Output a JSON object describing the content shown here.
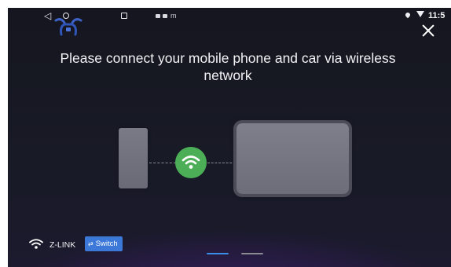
{
  "status_bar": {
    "back_icon": "nav-back-icon",
    "home_icon": "nav-home-icon",
    "recents_icon": "nav-recents-icon",
    "notification_c_glyph": "m",
    "time": "11:5"
  },
  "header": {
    "logo_icon": "zlink-logo-icon",
    "close_icon": "close-icon"
  },
  "main": {
    "instruction": "Please connect your mobile phone and car via wireless network",
    "wifi_badge_color": "#4caf57",
    "phone_icon": "phone-icon",
    "car_screen_icon": "car-screen-icon"
  },
  "footer": {
    "connection_label": "Z-LINK",
    "switch_label": "Switch",
    "switch_color": "#3c78d8",
    "page_indicator": {
      "count": 2,
      "active": 0,
      "active_color": "#3a8ee6"
    }
  }
}
